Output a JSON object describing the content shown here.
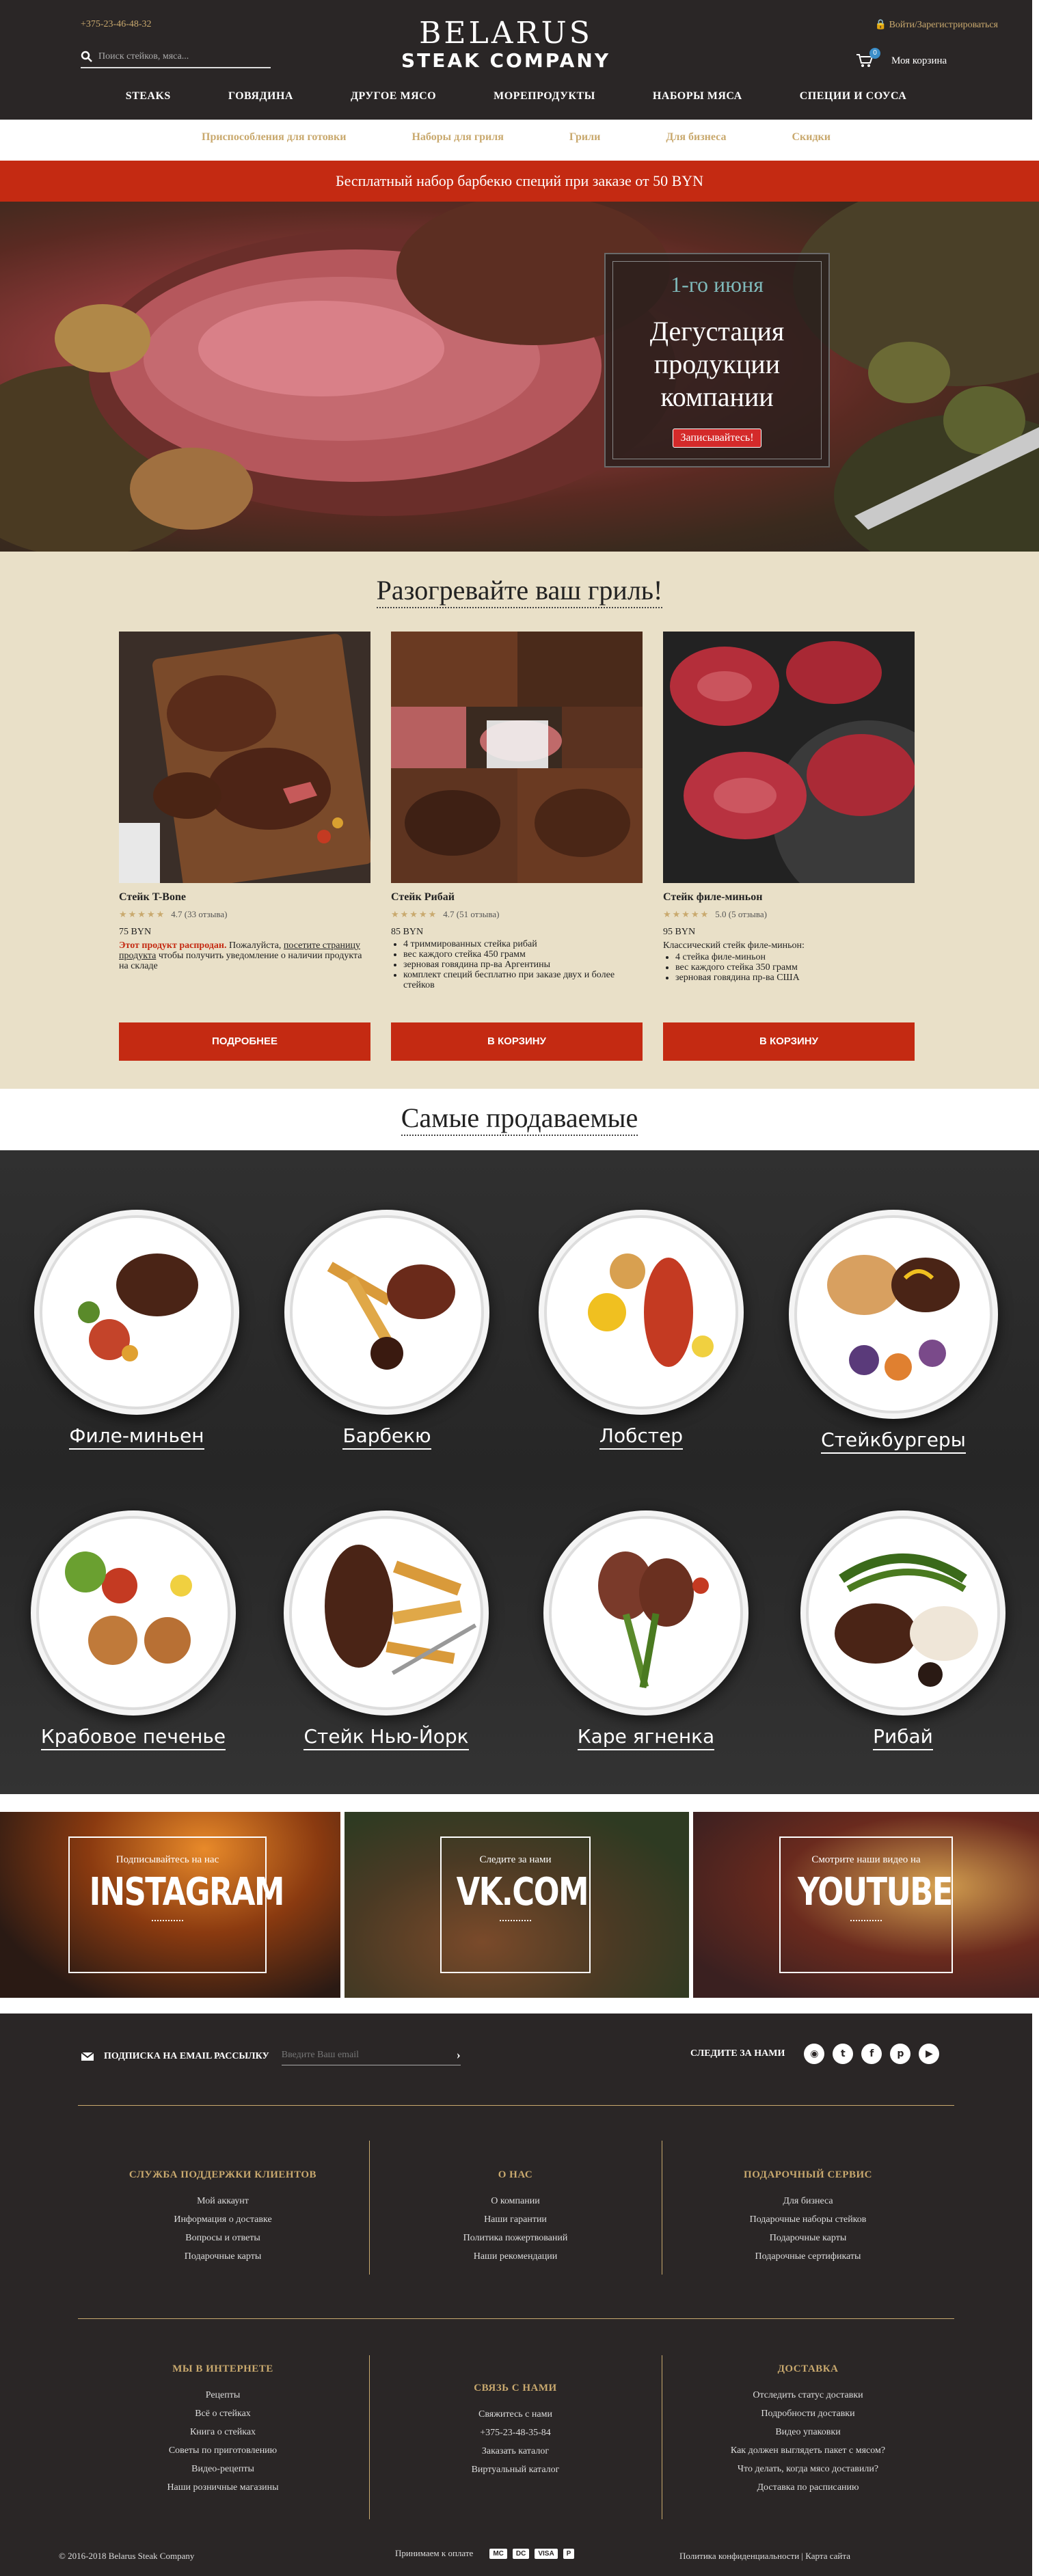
{
  "header": {
    "phone": "+375-23-46-48-32",
    "login": "Войти/Зарегистрироваться",
    "search_placeholder": "Поиск стейков, мяса...",
    "logo_line1": "BELARUS",
    "logo_line2": "STEAK COMPANY",
    "cart_count": "0",
    "cart_label": "Моя корзина"
  },
  "main_nav": [
    "STEAKS",
    "ГОВЯДИНА",
    "ДРУГОЕ МЯСО",
    "МОРЕПРОДУКТЫ",
    "НАБОРЫ МЯСА",
    "СПЕЦИИ И СОУСА"
  ],
  "sub_nav": [
    "Приспособления для готовки",
    "Наборы для гриля",
    "Грили",
    "Для бизнеса",
    "Скидки"
  ],
  "promo": "Бесплатный набор барбекю специй при заказе от 50 BYN",
  "hero": {
    "date": "1-го июня",
    "title_lines": [
      "Дегустация",
      "продукции",
      "компании"
    ],
    "button": "Записывайтесь!"
  },
  "grill": {
    "title": "Разогревайте ваш гриль!",
    "cards": [
      {
        "name": "Стейк T-Bone",
        "stars": "★★★★★",
        "rating": "4.7 (33 отзыва)",
        "price": "75 BYN",
        "sold_out": "Этот продукт распродан.",
        "note_a": "Пожалуйста,",
        "note_link": "посетите страницу продукта",
        "note_b": "чтобы получить уведомление о наличии продукта на складе",
        "button": "ПОДРОБНЕЕ"
      },
      {
        "name": "Стейк Рибай",
        "stars": "★★★★★",
        "rating": "4.7 (51 отзыва)",
        "price": "85 BYN",
        "bullets": [
          "4 триммированных стейка рибай",
          "вес каждого стейка 450 грамм",
          "зерновая говядина пр-ва Аргентины",
          "комплект специй бесплатно при заказе двух и более стейков"
        ],
        "button": "В КОРЗИНУ"
      },
      {
        "name": "Стейк филе-миньон",
        "stars": "★★★★★",
        "rating": "5.0 (5 отзыва)",
        "price": "95 BYN",
        "intro": "Классический стейк филе-миньон:",
        "bullets": [
          "4 стейка филе-миньон",
          "вес каждого стейка 350 грамм",
          "зерновая говядина пр-ва США"
        ],
        "button": "В КОРЗИНУ"
      }
    ]
  },
  "bestsellers": {
    "title": "Самые продаваемые",
    "items": [
      "Филе-миньен",
      "Барбекю",
      "Лобстер",
      "Стейкбургеры",
      "Крабовое печенье",
      "Стейк Нью-Йорк",
      "Каре ягненка",
      "Рибай"
    ]
  },
  "social": [
    {
      "small": "Подписывайтесь на нас",
      "big": "INSTAGRAM"
    },
    {
      "small": "Следите за нами",
      "big": "VK.COM"
    },
    {
      "small": "Смотрите наши видео на",
      "big": "YOUTUBE"
    }
  ],
  "footer": {
    "subscribe_label": "ПОДПИСКА НА EMAIL РАССЫЛКУ",
    "email_placeholder": "Введите Ваш email",
    "follow_label": "СЛЕДИТЕ ЗА НАМИ",
    "columns_top": [
      {
        "title": "СЛУЖБА ПОДДЕРЖКИ КЛИЕНТОВ",
        "links": [
          "Мой аккаунт",
          "Информация о доставке",
          "Вопросы и ответы",
          "Подарочные карты"
        ]
      },
      {
        "title": "О НАС",
        "links": [
          "О компании",
          "Наши гарантии",
          "Политика пожертвований",
          "Наши рекомендации"
        ]
      },
      {
        "title": "ПОДАРОЧНЫЙ СЕРВИС",
        "links": [
          "Для бизнеса",
          "Подарочные наборы стейков",
          "Подарочные карты",
          "Подарочные сертификаты"
        ]
      }
    ],
    "columns_bottom": [
      {
        "title": "МЫ В ИНТЕРНЕТЕ",
        "links": [
          "Рецепты",
          "Всё о стейках",
          "Книга о стейках",
          "Советы по приготовлению",
          "Видео-рецепты",
          "Наши розничные магазины"
        ]
      },
      {
        "title": "СВЯЗЬ С НАМИ",
        "links": [
          "Свяжитесь с нами",
          "+375-23-48-35-84",
          "Заказать каталог",
          "Виртуальный каталог"
        ]
      },
      {
        "title": "ДОСТАВКА",
        "links": [
          "Отследить статус доставки",
          "Подробности доставки",
          "Видео упаковки",
          "Как должен выглядеть пакет с мясом?",
          "Что делать, когда мясо доставили?",
          "Доставка по расписанию"
        ]
      }
    ],
    "copyright": "© 2016-2018 Belarus Steak Company",
    "payments_label": "Принимаем к оплате",
    "payments": [
      "MC",
      "DC",
      "VISA",
      "P"
    ],
    "legal": "Политика конфиденциальности | Карта сайта"
  }
}
